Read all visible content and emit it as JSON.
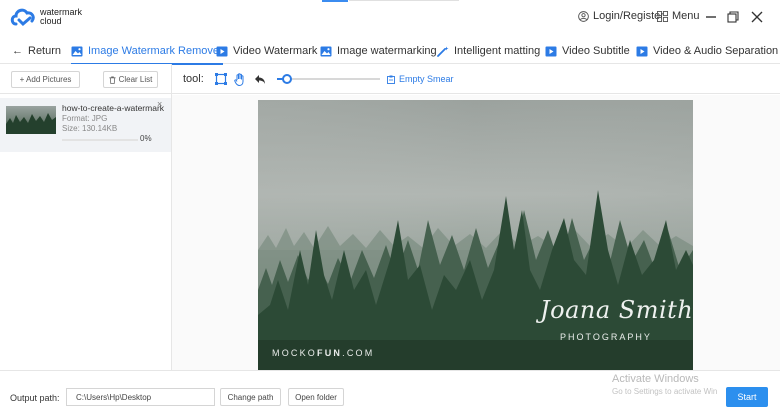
{
  "app": {
    "brand_line1": "watermark",
    "brand_line2": "cloud",
    "login_label": "Login/Register",
    "menu_label": "Menu"
  },
  "nav": {
    "back_label": "Return",
    "tabs": [
      {
        "label": "Image Watermark Remover",
        "active": true
      },
      {
        "label": "Video Watermark"
      },
      {
        "label": "Image watermarking"
      },
      {
        "label": "Intelligent matting"
      },
      {
        "label": "Video Subtitle"
      },
      {
        "label": "Video & Audio Separation"
      }
    ]
  },
  "left_panel": {
    "add_pictures": "+ Add Pictures",
    "clear_list": "Clear List",
    "file": {
      "name": "how-to-create-a-watermark",
      "format": "Format: JPG",
      "size": "Size: 130.14KB",
      "progress": "0%",
      "progress_value": 0,
      "close": "×"
    }
  },
  "toolbar": {
    "tool_label": "tool:",
    "empty_smear": "Empty Smear",
    "brush_size_fraction": 0.05
  },
  "preview": {
    "signature": "Joana Smith",
    "signature_sub": "PHOTOGRAPHY",
    "site_prefix": "MOCKO",
    "site_bold": "FUN",
    "site_suffix": ".COM"
  },
  "bottom": {
    "output_label": "Output path:",
    "output_value": "C:\\Users\\Hp\\Desktop",
    "change_path": "Change path",
    "open_folder": "Open folder",
    "activate_title": "Activate Windows",
    "activate_sub": "Go to Settings to activate Win",
    "start": "Start"
  },
  "colors": {
    "accent": "#2c7be5",
    "start_button": "#2c8fee"
  }
}
